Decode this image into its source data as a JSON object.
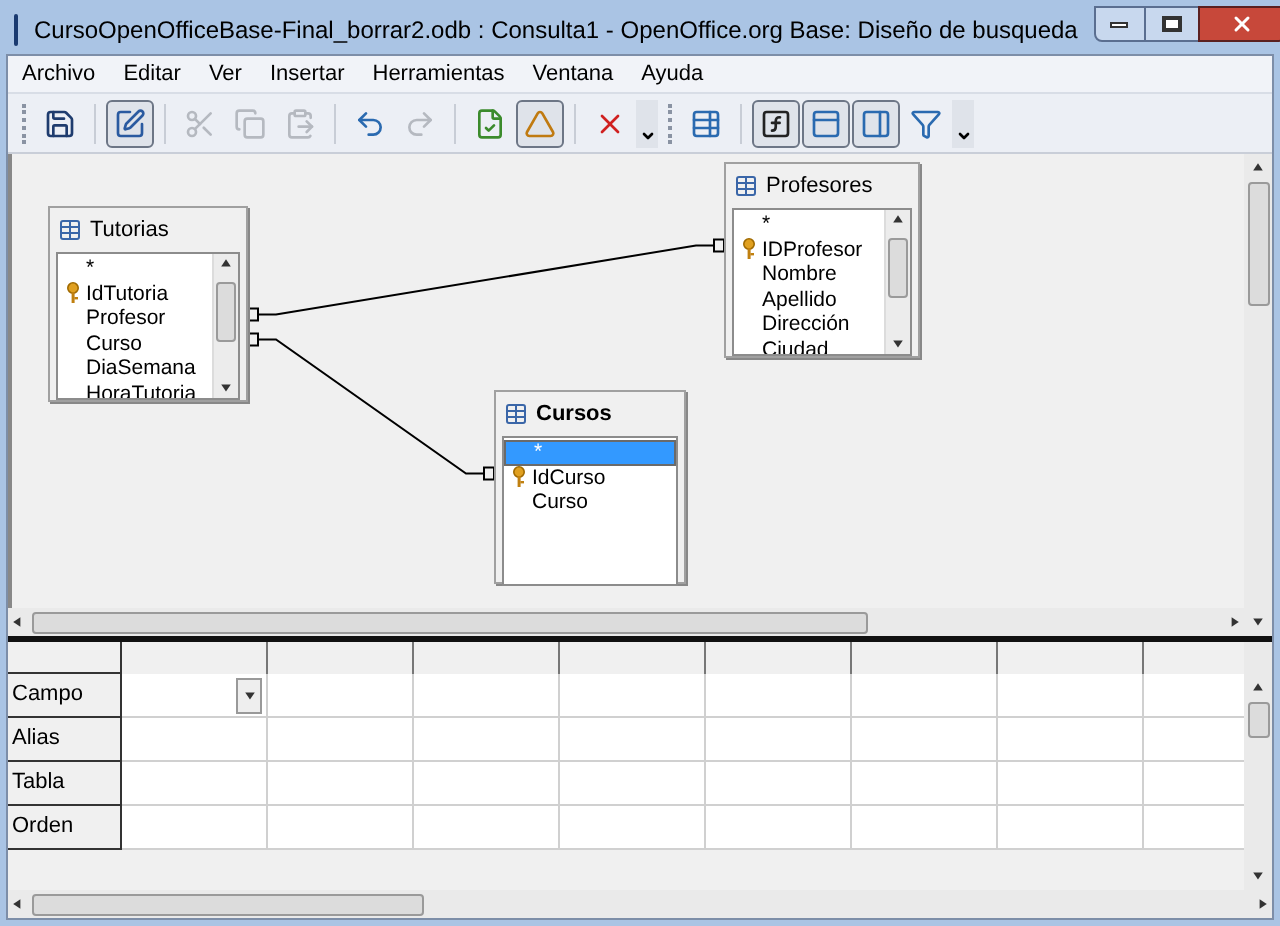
{
  "window": {
    "title": "CursoOpenOfficeBase-Final_borrar2.odb : Consulta1 - OpenOffice.org Base: Diseño de busqueda"
  },
  "menu": [
    "Archivo",
    "Editar",
    "Ver",
    "Insertar",
    "Herramientas",
    "Ventana",
    "Ayuda"
  ],
  "toolbar": [
    {
      "kind": "save",
      "active": false,
      "disabled": false
    },
    {
      "kind": "sep"
    },
    {
      "kind": "edit",
      "active": true,
      "disabled": false
    },
    {
      "kind": "sep"
    },
    {
      "kind": "cut",
      "active": false,
      "disabled": true
    },
    {
      "kind": "copy",
      "active": false,
      "disabled": true
    },
    {
      "kind": "paste",
      "active": false,
      "disabled": true
    },
    {
      "kind": "sep"
    },
    {
      "kind": "undo",
      "active": false,
      "disabled": false
    },
    {
      "kind": "redo",
      "active": false,
      "disabled": true
    },
    {
      "kind": "sep"
    },
    {
      "kind": "run",
      "active": false,
      "disabled": false
    },
    {
      "kind": "design",
      "active": true,
      "disabled": false
    },
    {
      "kind": "sep"
    },
    {
      "kind": "delete",
      "active": false,
      "disabled": false
    },
    {
      "kind": "more"
    },
    {
      "kind": "grip"
    },
    {
      "kind": "addtable",
      "active": false,
      "disabled": false
    },
    {
      "kind": "sep"
    },
    {
      "kind": "function",
      "active": true,
      "disabled": false
    },
    {
      "kind": "tablename",
      "active": true,
      "disabled": false
    },
    {
      "kind": "alias",
      "active": true,
      "disabled": false
    },
    {
      "kind": "distinct",
      "active": false,
      "disabled": false
    },
    {
      "kind": "more"
    }
  ],
  "tables": [
    {
      "title": "Tutorias",
      "bold": false,
      "fields": [
        {
          "name": "*",
          "key": false,
          "selected": false
        },
        {
          "name": "IdTutoria",
          "key": true,
          "selected": false
        },
        {
          "name": "Profesor",
          "key": false,
          "selected": false
        },
        {
          "name": "Curso",
          "key": false,
          "selected": false
        },
        {
          "name": "DiaSemana",
          "key": false,
          "selected": false
        },
        {
          "name": "HoraTutoria",
          "key": false,
          "selected": false
        }
      ],
      "scrollbar": true
    },
    {
      "title": "Profesores",
      "bold": false,
      "fields": [
        {
          "name": "*",
          "key": false,
          "selected": false
        },
        {
          "name": "IDProfesor",
          "key": true,
          "selected": false
        },
        {
          "name": "Nombre",
          "key": false,
          "selected": false
        },
        {
          "name": "Apellido",
          "key": false,
          "selected": false
        },
        {
          "name": "Dirección",
          "key": false,
          "selected": false
        },
        {
          "name": "Ciudad",
          "key": false,
          "selected": false
        }
      ],
      "scrollbar": true
    },
    {
      "title": "Cursos",
      "bold": true,
      "fields": [
        {
          "name": "*",
          "key": false,
          "selected": true
        },
        {
          "name": "IdCurso",
          "key": true,
          "selected": false
        },
        {
          "name": "Curso",
          "key": false,
          "selected": false
        }
      ],
      "scrollbar": false
    }
  ],
  "grid": {
    "rows": [
      "Campo",
      "Alias",
      "Tabla",
      "Orden"
    ]
  }
}
